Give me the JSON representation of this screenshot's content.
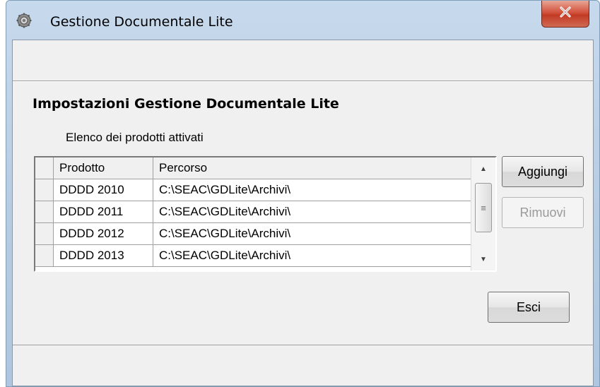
{
  "window": {
    "title": "Gestione Documentale Lite",
    "close_glyph": "✕"
  },
  "main": {
    "section_title": "Impostazioni Gestione Documentale Lite",
    "list_label": "Elenco dei prodotti attivati",
    "grid": {
      "columns": [
        "Prodotto",
        "Percorso"
      ],
      "rows": [
        {
          "prodotto": "DDDD 2010",
          "percorso": "C:\\SEAC\\GDLite\\Archivi\\"
        },
        {
          "prodotto": "DDDD 2011",
          "percorso": "C:\\SEAC\\GDLite\\Archivi\\"
        },
        {
          "prodotto": "DDDD 2012",
          "percorso": "C:\\SEAC\\GDLite\\Archivi\\"
        },
        {
          "prodotto": "DDDD 2013",
          "percorso": "C:\\SEAC\\GDLite\\Archivi\\"
        }
      ]
    },
    "buttons": {
      "add": "Aggiungi",
      "remove": "Rimuovi",
      "exit": "Esci"
    }
  },
  "icons": {
    "app": "gear-icon",
    "close": "close-icon",
    "scroll_up": "scroll-up-arrow-icon",
    "scroll_down": "scroll-down-arrow-icon"
  },
  "colors": {
    "close_button": "#c23a24",
    "client_bg": "#f0f0f0",
    "frame": "#b5cbe2"
  }
}
